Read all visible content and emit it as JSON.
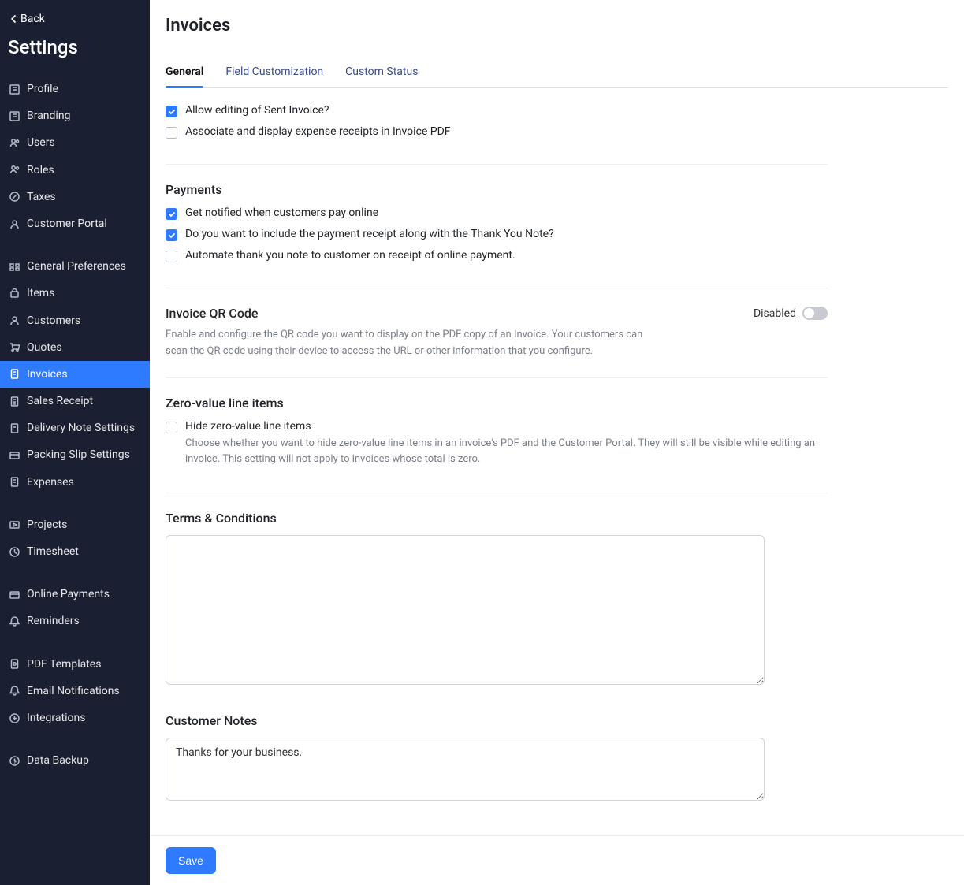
{
  "sidebar": {
    "back": "Back",
    "title": "Settings",
    "groups": [
      [
        "Profile",
        "Branding",
        "Users",
        "Roles",
        "Taxes",
        "Customer Portal"
      ],
      [
        "General Preferences",
        "Items",
        "Customers",
        "Quotes",
        "Invoices",
        "Sales Receipt",
        "Delivery Note Settings",
        "Packing Slip Settings",
        "Expenses"
      ],
      [
        "Projects",
        "Timesheet"
      ],
      [
        "Online Payments",
        "Reminders"
      ],
      [
        "PDF Templates",
        "Email Notifications",
        "Integrations"
      ],
      [
        "Data Backup"
      ]
    ],
    "active": "Invoices"
  },
  "page": {
    "title": "Invoices"
  },
  "tabs": {
    "items": [
      "General",
      "Field Customization",
      "Custom Status"
    ],
    "active": "General"
  },
  "topChecks": [
    {
      "label": "Allow editing of Sent Invoice?",
      "checked": true
    },
    {
      "label": "Associate and display expense receipts in Invoice PDF",
      "checked": false
    }
  ],
  "payments": {
    "title": "Payments",
    "items": [
      {
        "label": "Get notified when customers pay online",
        "checked": true
      },
      {
        "label": "Do you want to include the payment receipt along with the Thank You Note?",
        "checked": true
      },
      {
        "label": "Automate thank you note to customer on receipt of online payment.",
        "checked": false
      }
    ]
  },
  "qr": {
    "title": "Invoice QR Code",
    "state": "Disabled",
    "desc": "Enable and configure the QR code you want to display on the PDF copy of an Invoice. Your customers can scan the QR code using their device to access the URL or other information that you configure."
  },
  "zero": {
    "title": "Zero-value line items",
    "item": {
      "label": "Hide zero-value line items",
      "checked": false,
      "help": "Choose whether you want to hide zero-value line items in an invoice's PDF and the Customer Portal. They will still be visible while editing an invoice. This setting will not apply to invoices whose total is zero."
    }
  },
  "terms": {
    "title": "Terms & Conditions",
    "value": ""
  },
  "notes": {
    "title": "Customer Notes",
    "value": "Thanks for your business."
  },
  "footer": {
    "save": "Save"
  }
}
